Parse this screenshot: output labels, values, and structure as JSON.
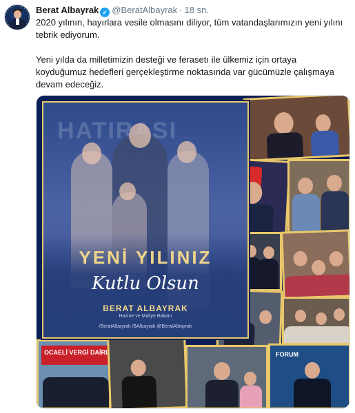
{
  "tweet": {
    "author_name": "Berat Albayrak",
    "handle": "@BeratAlbayrak",
    "separator": "·",
    "time": "18 sn.",
    "verified_mark": "✓",
    "paragraph1": "2020 yılının, hayırlara vesile olmasını diliyor, tüm vatandaşlarımızın yeni yılını tebrik ediyorum.",
    "paragraph2": "Yeni yılda da milletimizin desteği ve ferasetı ile ülkemiz için ortaya koyduğumuz hedefleri gerçekleştirme noktasında var gücümüzle çalışmaya devam edeceğiz."
  },
  "media": {
    "background_text": "HATIRASI",
    "greeting_line1": "YENİ YILINIZ",
    "greeting_line2": "Kutlu Olsun",
    "signature_name": "BERAT ALBAYRAK",
    "signature_title": "Hazine ve Maliye Bakanı",
    "social_handles": "/BeratAlbayrak   /BAlbayrak   @BeratAlbayrak",
    "sign_text": "OCAELİ VERGİ DAİRESİ",
    "forum_text": "FORUM"
  },
  "colors": {
    "accent": "#1da1f2",
    "gold": "#e9c86b",
    "navy": "#0b1f57"
  },
  "icons": {
    "verified": "verified-badge-icon"
  }
}
